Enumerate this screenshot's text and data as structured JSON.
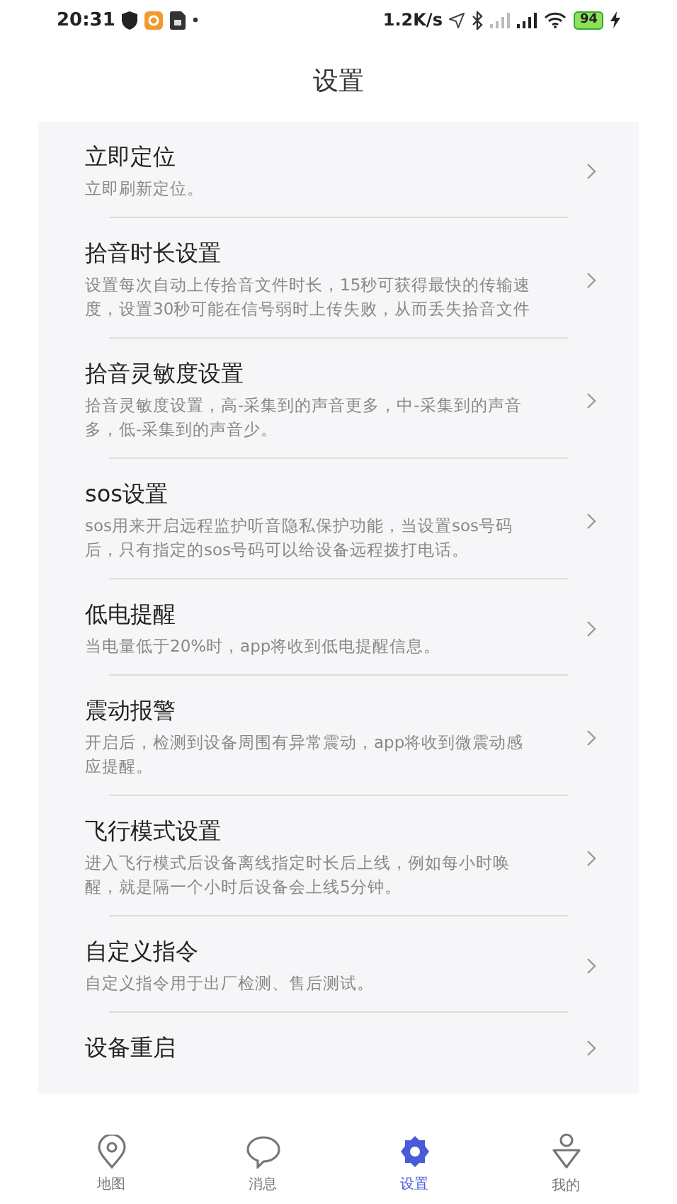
{
  "status_bar": {
    "time": "20:31",
    "speed": "1.2K/s",
    "battery": "94"
  },
  "title": "设置",
  "settings": [
    {
      "title": "立即定位",
      "description": "立即刷新定位。"
    },
    {
      "title": "拾音时长设置",
      "description": "设置每次自动上传拾音文件时长，15秒可获得最快的传输速度，设置30秒可能在信号弱时上传失败，从而丢失拾音文件"
    },
    {
      "title": "拾音灵敏度设置",
      "description": "拾音灵敏度设置，高-采集到的声音更多，中-采集到的声音多，低-采集到的声音少。"
    },
    {
      "title": "sos设置",
      "description": "sos用来开启远程监护听音隐私保护功能，当设置sos号码后，只有指定的sos号码可以给设备远程拨打电话。"
    },
    {
      "title": "低电提醒",
      "description": "当电量低于20%时，app将收到低电提醒信息。"
    },
    {
      "title": "震动报警",
      "description": "开启后，检测到设备周围有异常震动，app将收到微震动感应提醒。"
    },
    {
      "title": "飞行模式设置",
      "description": "进入飞行模式后设备离线指定时长后上线，例如每小时唤醒，就是隔一个小时后设备会上线5分钟。"
    },
    {
      "title": "自定义指令",
      "description": "自定义指令用于出厂检测、售后测试。"
    },
    {
      "title": "设备重启"
    }
  ],
  "tabs": [
    {
      "kind": "map",
      "label": "地图",
      "selected": false
    },
    {
      "kind": "message",
      "label": "消息",
      "selected": false
    },
    {
      "kind": "settings",
      "label": "设置",
      "selected": true
    },
    {
      "kind": "profile",
      "label": "我的",
      "selected": false
    }
  ]
}
